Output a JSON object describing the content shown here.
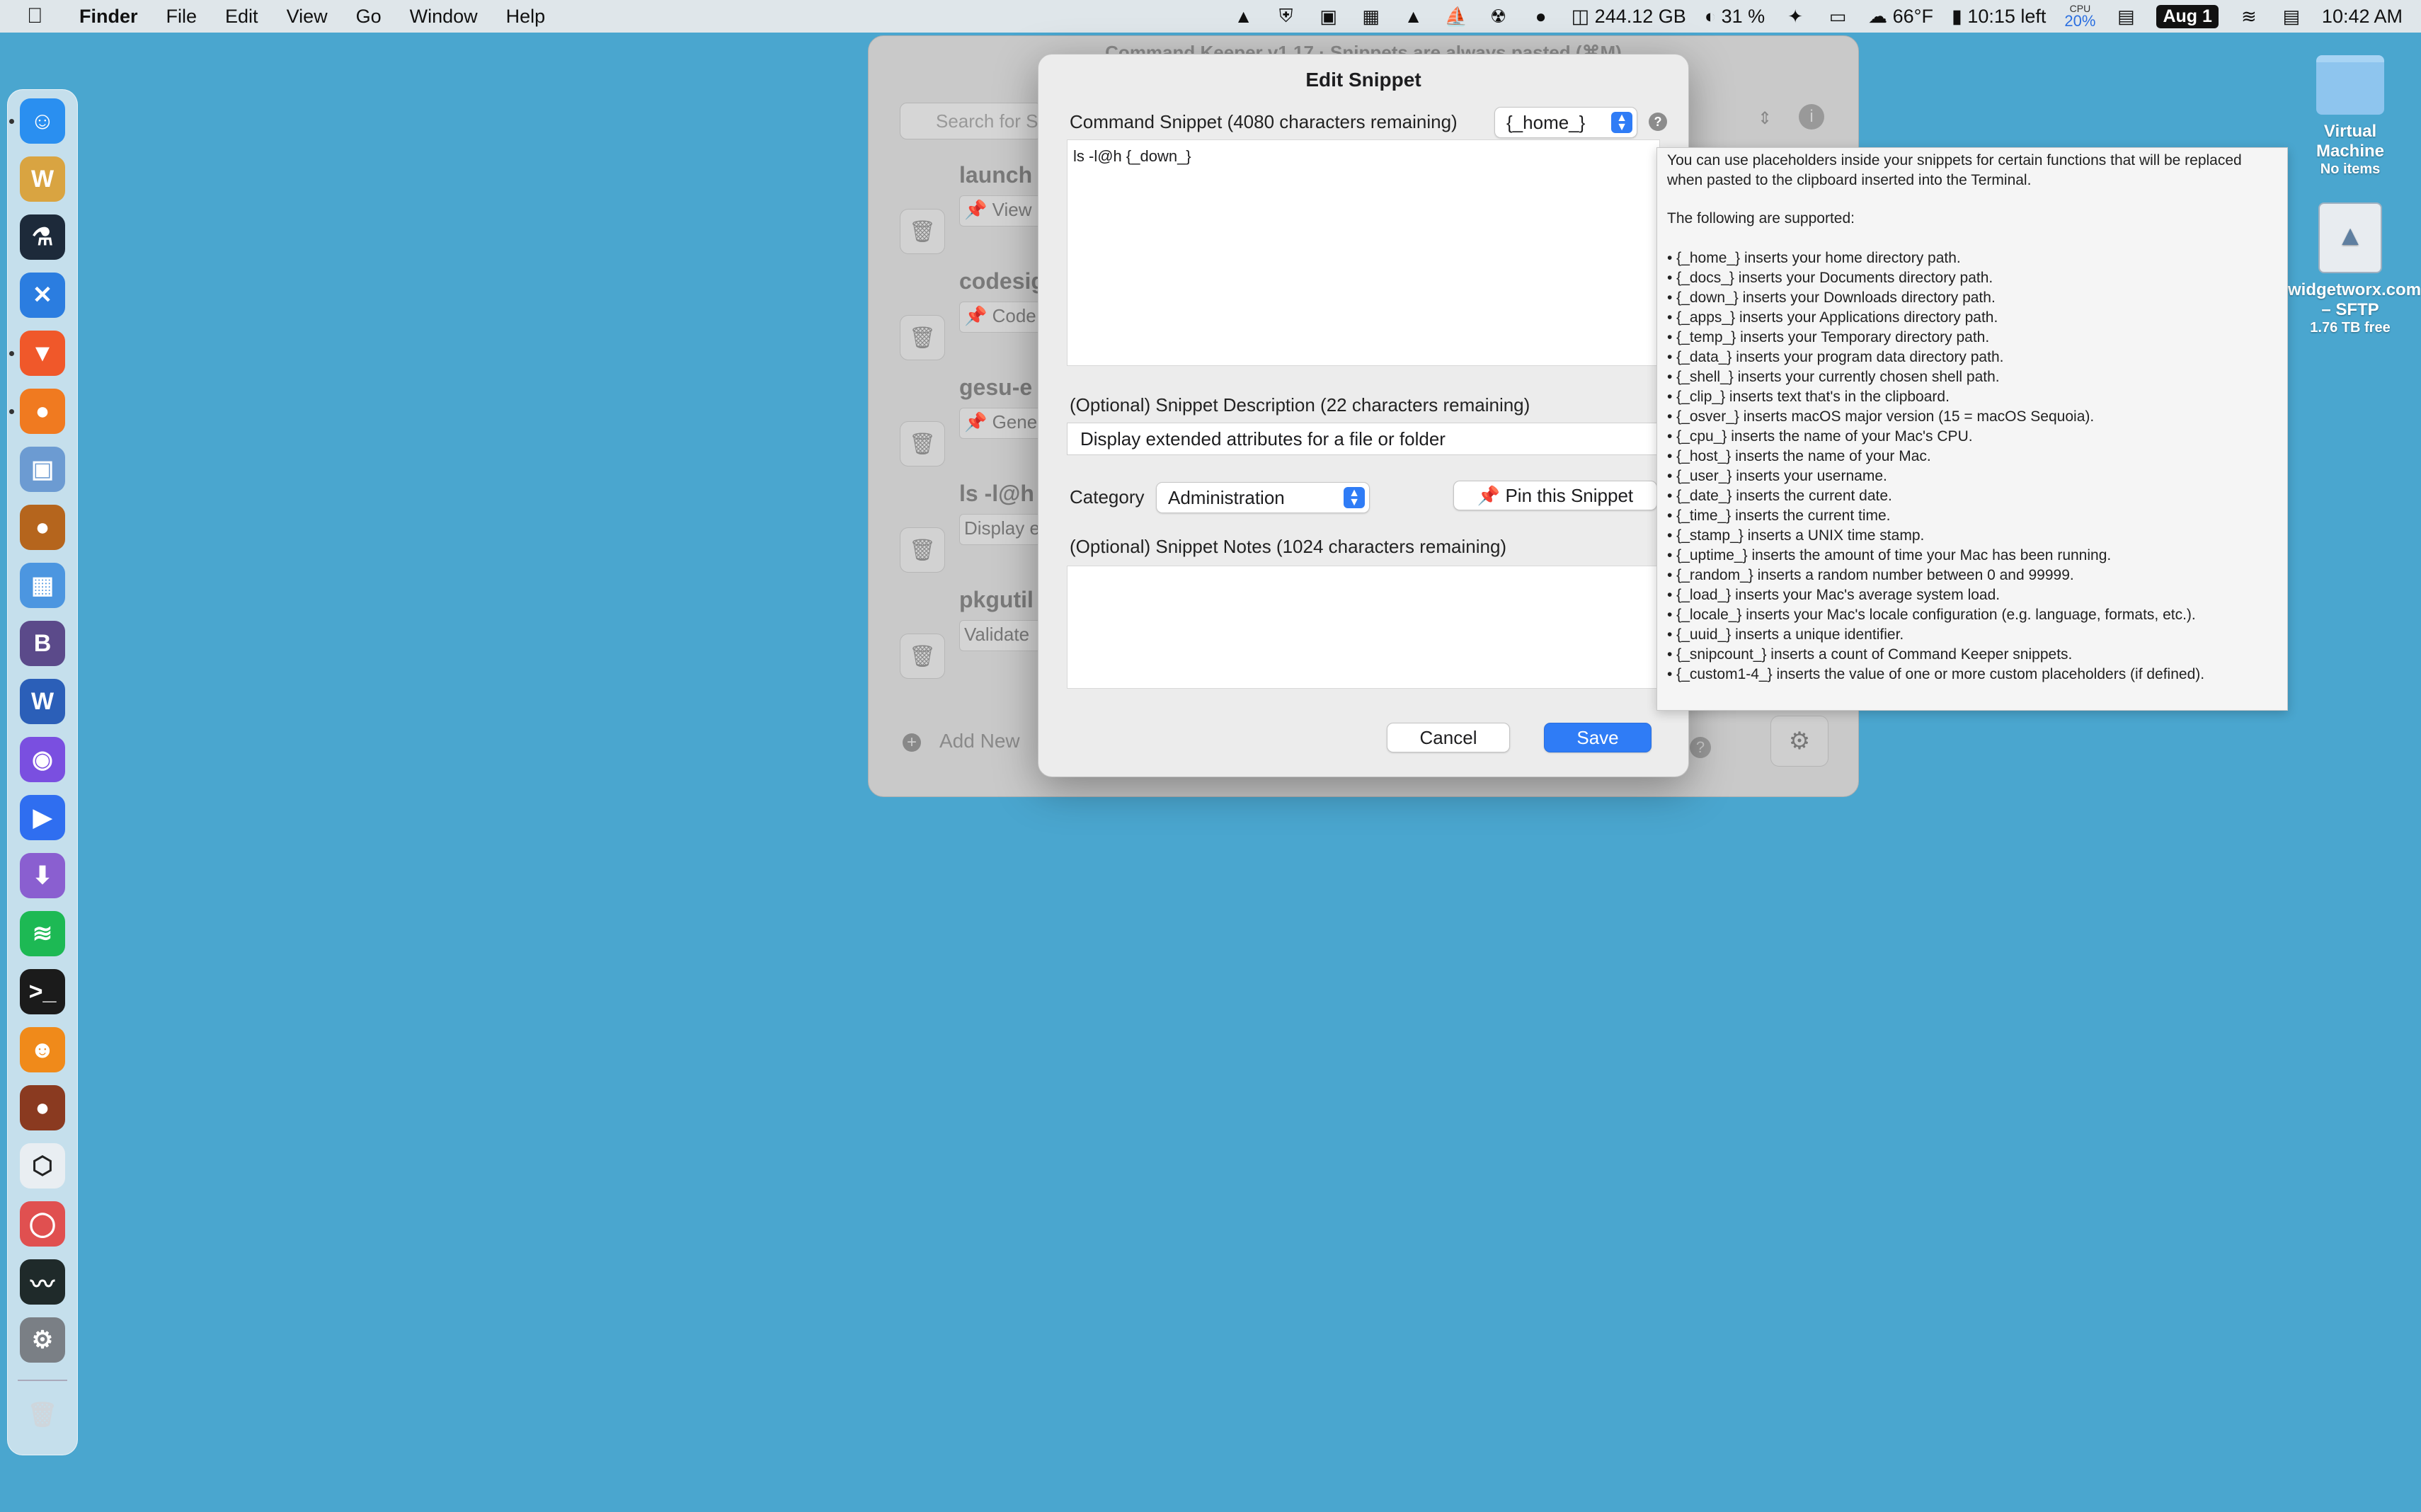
{
  "menubar": {
    "app_name": "Finder",
    "menus": [
      "File",
      "Edit",
      "View",
      "Go",
      "Window",
      "Help"
    ],
    "disk_free": "244.12 GB",
    "cpu_percent": "31 %",
    "weather": "66°F",
    "battery_text": "10:15 left",
    "cpu_label": "CPU",
    "cpu_value": "20%",
    "date_badge": "Aug 1",
    "clock": "10:42 AM"
  },
  "desktop": {
    "vm_name": "Virtual Machine",
    "vm_sub": "No items",
    "sftp_name": "widgetworx.com – SFTP",
    "sftp_sub": "1.76 TB free"
  },
  "background_window": {
    "title": "Command Keeper v1.17 · Snippets are always pasted (⌘M)",
    "search_placeholder": "Search for S",
    "cards": [
      {
        "title": "launch",
        "subtitle": "📌 View"
      },
      {
        "title": "codesig",
        "subtitle": "📌 Code"
      },
      {
        "title": "gesu-e",
        "subtitle": "📌 Gene"
      },
      {
        "title": "ls -l@h",
        "subtitle": "Display e"
      },
      {
        "title": "pkgutil",
        "subtitle": "Validate"
      }
    ],
    "add_new": "Add New"
  },
  "sheet": {
    "title": "Edit Snippet",
    "command_label": "Command Snippet (4080 characters remaining)",
    "placeholder_select": "{_home_}",
    "command_value": "ls -l@h {_down_}",
    "description_label": "(Optional) Snippet Description (22 characters remaining)",
    "description_value": "Display extended attributes for a file or folder",
    "category_label": "Category",
    "category_value": "Administration",
    "pin_label": "📌 Pin this Snippet",
    "notes_label": "(Optional) Snippet Notes (1024 characters remaining)",
    "cancel": "Cancel",
    "save": "Save"
  },
  "tooltip": {
    "intro": "You can use placeholders inside your snippets for certain functions that will be replaced when pasted to the clipboard inserted into the Terminal.",
    "supported": "The following are supported:",
    "items": [
      "• {_home_} inserts your home directory path.",
      "• {_docs_} inserts your Documents directory path.",
      "• {_down_} inserts your Downloads directory path.",
      "• {_apps_} inserts your Applications directory path.",
      "• {_temp_} inserts your Temporary directory path.",
      "• {_data_} inserts your program data directory path.",
      "• {_shell_} inserts your currently chosen shell path.",
      "• {_clip_} inserts text that's in the clipboard.",
      "• {_osver_} inserts macOS major version (15 = macOS Sequoia).",
      "• {_cpu_} inserts the name of your Mac's CPU.",
      "• {_host_} inserts the name of your Mac.",
      "• {_user_} inserts your username.",
      "• {_date_} inserts the current date.",
      "• {_time_} inserts the current time.",
      "• {_stamp_} inserts a UNIX time stamp.",
      "• {_uptime_} inserts the amount of time your Mac has been running.",
      "• {_random_} inserts a random number between 0 and 99999.",
      "• {_load_} inserts your Mac's average system load.",
      "• {_locale_} inserts your Mac's locale configuration (e.g. language, formats, etc.).",
      "• {_uuid_} inserts a unique identifier.",
      "• {_snipcount_} inserts a count of Command Keeper snippets.",
      "• {_custom1-4_} inserts the value of one or more custom placeholders (if defined)."
    ]
  },
  "dock": {
    "icons": [
      {
        "name": "finder-icon",
        "glyph": "☺",
        "color": "#2a8ff0"
      },
      {
        "name": "word-processor-icon",
        "glyph": "W",
        "color": "#d9a441"
      },
      {
        "name": "lab-flask-icon",
        "glyph": "⚗",
        "color": "#1d2a3a"
      },
      {
        "name": "tools-icon",
        "glyph": "✕",
        "color": "#2b7de0"
      },
      {
        "name": "brave-browser-icon",
        "glyph": "▼",
        "color": "#f0582a"
      },
      {
        "name": "firefox-icon",
        "glyph": "●",
        "color": "#f07a20"
      },
      {
        "name": "preview-icon",
        "glyph": "▣",
        "color": "#6c9bd2"
      },
      {
        "name": "acorn-icon",
        "glyph": "●",
        "color": "#b5651d"
      },
      {
        "name": "photos-app-icon",
        "glyph": "▦",
        "color": "#4c96e0"
      },
      {
        "name": "bbedit-icon",
        "glyph": "B",
        "color": "#5b4a8a"
      },
      {
        "name": "microsoft-word-icon",
        "glyph": "W",
        "color": "#2b5fb8"
      },
      {
        "name": "arc-browser-icon",
        "glyph": "◉",
        "color": "#7a4fe0"
      },
      {
        "name": "media-player-icon",
        "glyph": "▶",
        "color": "#2f6ef0"
      },
      {
        "name": "downloader-icon",
        "glyph": "⬇",
        "color": "#8a5fd0"
      },
      {
        "name": "spotify-icon",
        "glyph": "≋",
        "color": "#1db954"
      },
      {
        "name": "terminal-icon",
        "glyph": ">_",
        "color": "#1b1b1b"
      },
      {
        "name": "beta-app-icon",
        "glyph": "☻",
        "color": "#f08a1a"
      },
      {
        "name": "coffee-beans-icon",
        "glyph": "●",
        "color": "#8a3a20"
      },
      {
        "name": "hexagon-app-icon",
        "glyph": "⬡",
        "color": "#e9eef2"
      },
      {
        "name": "ring-app-icon",
        "glyph": "◯",
        "color": "#e05050"
      },
      {
        "name": "activity-monitor-icon",
        "glyph": "〰",
        "color": "#1f2a2a"
      },
      {
        "name": "system-settings-icon",
        "glyph": "⚙",
        "color": "#7a7f85"
      }
    ],
    "trash_glyph": "🗑"
  }
}
